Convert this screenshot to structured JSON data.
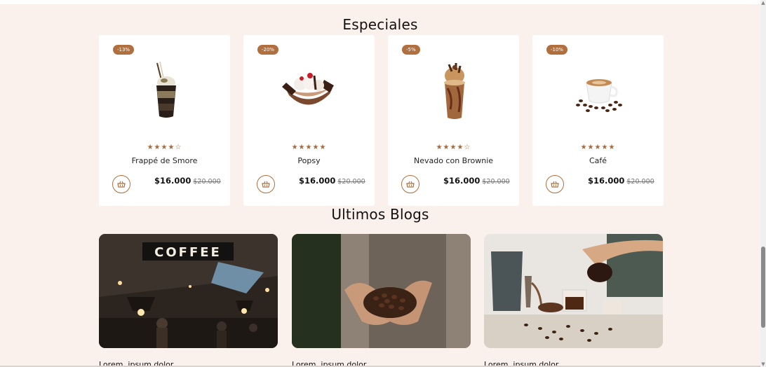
{
  "sections": {
    "especiales_title": "Especiales",
    "blogs_title": "Ultimos Blogs"
  },
  "products": [
    {
      "badge": "-13%",
      "stars": "★★★★☆",
      "name": "Frappé de Smore",
      "price": "$16.000",
      "old_price": "$20.000",
      "image_icon": "frappe-image"
    },
    {
      "badge": "-20%",
      "stars": "★★★★★",
      "name": "Popsy",
      "price": "$16.000",
      "old_price": "$20.000",
      "image_icon": "sundae-image"
    },
    {
      "badge": "-5%",
      "stars": "★★★★☆",
      "name": "Nevado con Brownie",
      "price": "$16.000",
      "old_price": "$20.000",
      "image_icon": "nevado-image"
    },
    {
      "badge": "-10%",
      "stars": "★★★★★",
      "name": "Café",
      "price": "$16.000",
      "old_price": "$20.000",
      "image_icon": "coffee-cup-image"
    }
  ],
  "blogs": [
    {
      "caption": "Lorem. ipsum dolor",
      "sign_text": "COFFEE"
    },
    {
      "caption": "Lorem. ipsum dolor"
    },
    {
      "caption": "Lorem. ipsum dolor"
    }
  ],
  "colors": {
    "background": "#faf1ec",
    "accent": "#b06f3c",
    "card": "#ffffff"
  }
}
